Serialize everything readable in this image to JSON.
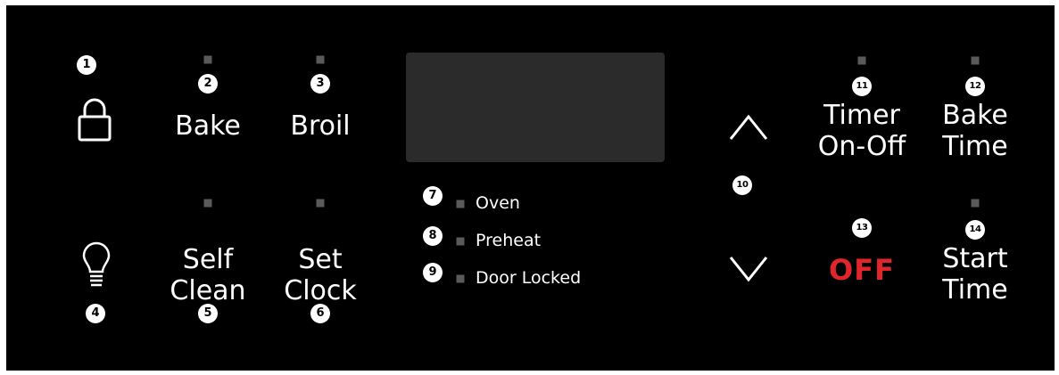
{
  "buttons": {
    "lock": {
      "callout": "1",
      "icon": "lock-icon"
    },
    "bake": {
      "callout": "2",
      "label": "Bake"
    },
    "broil": {
      "callout": "3",
      "label": "Broil"
    },
    "light": {
      "callout": "4",
      "icon": "light-bulb-icon"
    },
    "self_clean": {
      "callout": "5",
      "line1": "Self",
      "line2": "Clean"
    },
    "set_clock": {
      "callout": "6",
      "line1": "Set",
      "line2": "Clock"
    },
    "arrows": {
      "callout": "10",
      "up_icon": "chevron-up-icon",
      "down_icon": "chevron-down-icon"
    },
    "timer": {
      "callout": "11",
      "line1": "Timer",
      "line2": "On-Off"
    },
    "bake_time": {
      "callout": "12",
      "line1": "Bake",
      "line2": "Time"
    },
    "off": {
      "callout": "13",
      "label": "OFF"
    },
    "start_time": {
      "callout": "14",
      "line1": "Start",
      "line2": "Time"
    }
  },
  "indicators": [
    {
      "callout": "7",
      "label": "Oven"
    },
    {
      "callout": "8",
      "label": "Preheat"
    },
    {
      "callout": "9",
      "label": "Door Locked"
    }
  ],
  "colors": {
    "panel": "#000000",
    "display": "#2b2b2b",
    "led_off": "#5a5a5a",
    "off_text": "#e0262b",
    "callout": "#ffffff"
  }
}
